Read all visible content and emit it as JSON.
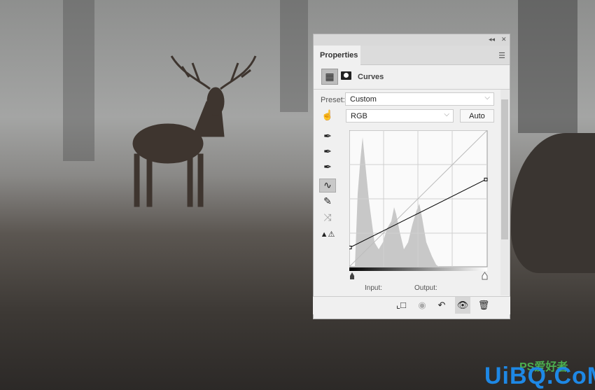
{
  "panel": {
    "tab_label": "Properties",
    "adjustment_title": "Curves",
    "preset_label": "Preset:",
    "preset_value": "Custom",
    "channel_value": "RGB",
    "auto_label": "Auto",
    "input_label": "Input:",
    "output_label": "Output:",
    "curve_points": [
      {
        "input": 0,
        "output": 36
      },
      {
        "input": 255,
        "output": 163
      }
    ]
  },
  "watermark": {
    "text": "UiBQ.CoM",
    "sub": "PS爱好者"
  },
  "colors": {
    "panel_bg": "#f0f0f0",
    "curve": "#000000",
    "histogram": "#c8c8c8"
  }
}
